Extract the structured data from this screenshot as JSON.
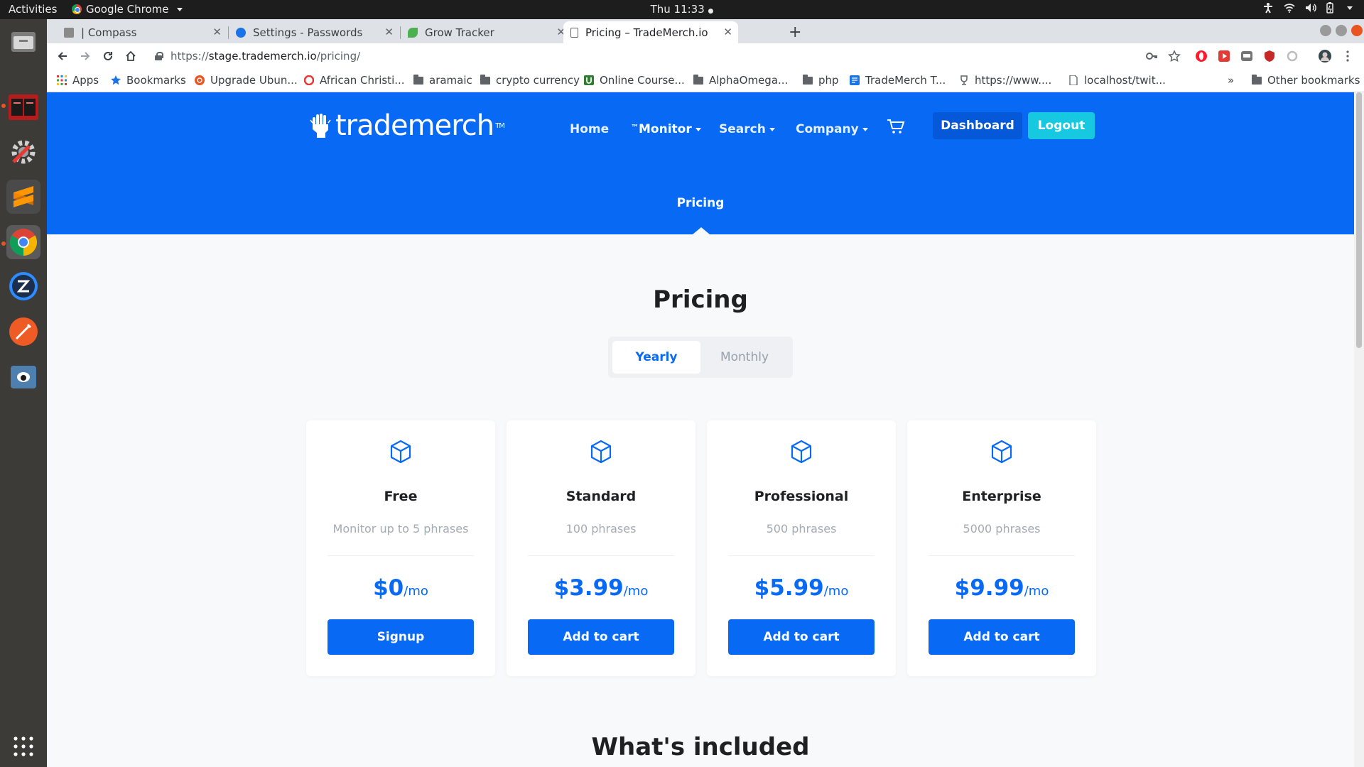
{
  "system": {
    "activities": "Activities",
    "app_name": "Google Chrome",
    "clock": "Thu 11:33",
    "clock_dot": "●"
  },
  "browser": {
    "tabs": [
      {
        "title": "| Compass"
      },
      {
        "title": "Settings - Passwords"
      },
      {
        "title": "Grow Tracker"
      },
      {
        "title": "Pricing – TradeMerch.io"
      }
    ],
    "url_scheme": "https://",
    "url_host": "stage.trademerch.io",
    "url_path": "/pricing/",
    "bookmarks": [
      {
        "label": "Apps",
        "icon": "apps-grid-icon"
      },
      {
        "label": "Bookmarks",
        "icon": "star-icon"
      },
      {
        "label": "Upgrade Ubun...",
        "icon": "ubuntu-icon"
      },
      {
        "label": "African Christi...",
        "icon": "opera-icon"
      },
      {
        "label": "aramaic",
        "icon": "folder-icon"
      },
      {
        "label": "crypto currency",
        "icon": "folder-icon"
      },
      {
        "label": "Online Course...",
        "icon": "udemy-icon"
      },
      {
        "label": "AlphaOmega...",
        "icon": "folder-icon"
      },
      {
        "label": "php",
        "icon": "folder-icon"
      },
      {
        "label": "TradeMerch T...",
        "icon": "doc-icon"
      },
      {
        "label": "https://www....",
        "icon": "trophy-icon"
      },
      {
        "label": "localhost/twit...",
        "icon": "page-icon"
      }
    ],
    "bookmarks_overflow": "»",
    "other_bookmarks": "Other bookmarks"
  },
  "site": {
    "logo_text": "trademerch",
    "logo_tm": "TM",
    "nav": {
      "home": "Home",
      "monitor_prefix": "™",
      "monitor": "Monitor",
      "search": "Search",
      "company": "Company"
    },
    "dashboard": "Dashboard",
    "logout": "Logout",
    "breadcrumb": "Pricing"
  },
  "pricing": {
    "title": "Pricing",
    "toggle": {
      "yearly": "Yearly",
      "monthly": "Monthly",
      "selected": "Yearly"
    },
    "plans": [
      {
        "name": "Free",
        "desc": "Monitor up to 5 phrases",
        "price": "$0",
        "period": "/mo",
        "cta": "Signup"
      },
      {
        "name": "Standard",
        "desc": "100 phrases",
        "price": "$3.99",
        "period": "/mo",
        "cta": "Add to cart"
      },
      {
        "name": "Professional",
        "desc": "500 phrases",
        "price": "$5.99",
        "period": "/mo",
        "cta": "Add to cart"
      },
      {
        "name": "Enterprise",
        "desc": "5000 phrases",
        "price": "$9.99",
        "period": "/mo",
        "cta": "Add to cart"
      }
    ],
    "included_title": "What's included"
  },
  "colors": {
    "brand_blue": "#0869f5",
    "logout_cyan": "#17c9e0",
    "dashboard_blue": "#0558d8"
  }
}
